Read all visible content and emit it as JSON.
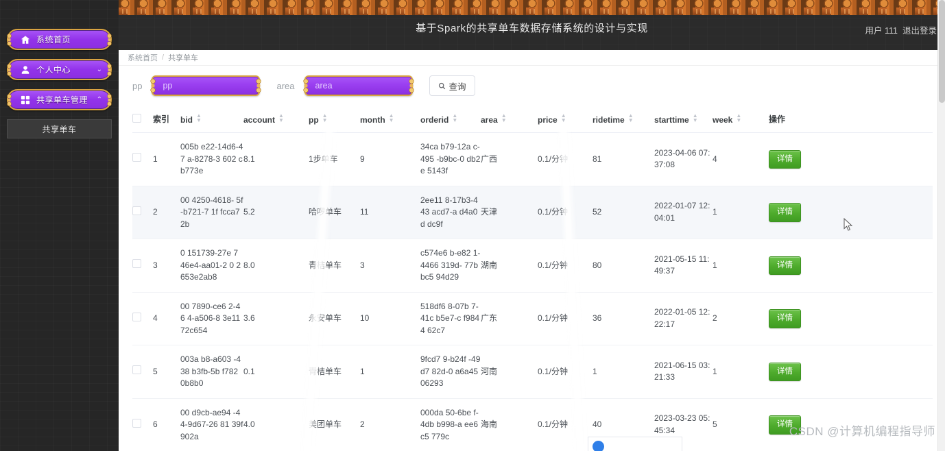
{
  "sidebar": {
    "items": [
      {
        "label": "系统首页",
        "icon": "home-icon",
        "chevron": ""
      },
      {
        "label": "个人中心",
        "icon": "user-icon",
        "chevron": "⌄"
      },
      {
        "label": "共享单车管理",
        "icon": "grid-icon",
        "chevron": "⌃"
      }
    ],
    "sub_item": "共享单车"
  },
  "topbar": {
    "title": "基于Spark的共享单车数据存储系统的设计与实现",
    "user": "用户 111",
    "logout": "退出登录"
  },
  "breadcrumb": {
    "home": "系统首页",
    "separator": "/",
    "current": "共享单车"
  },
  "search": {
    "pp_label": "pp",
    "pp_value": "",
    "pp_placeholder": "pp",
    "area_label": "area",
    "area_value": "",
    "area_placeholder": "area",
    "query_button": "查询"
  },
  "table": {
    "columns": [
      {
        "key": "index",
        "label": "索引",
        "sortable": false
      },
      {
        "key": "bid",
        "label": "bid",
        "sortable": true
      },
      {
        "key": "account",
        "label": "account",
        "sortable": true
      },
      {
        "key": "pp",
        "label": "pp",
        "sortable": true
      },
      {
        "key": "month",
        "label": "month",
        "sortable": true
      },
      {
        "key": "orderid",
        "label": "orderid",
        "sortable": true
      },
      {
        "key": "area",
        "label": "area",
        "sortable": true
      },
      {
        "key": "price",
        "label": "price",
        "sortable": true
      },
      {
        "key": "ridetime",
        "label": "ridetime",
        "sortable": true
      },
      {
        "key": "starttime",
        "label": "starttime",
        "sortable": true
      },
      {
        "key": "week",
        "label": "week",
        "sortable": true
      },
      {
        "key": "action",
        "label": "操作",
        "sortable": false
      }
    ],
    "action_label": "详情",
    "rows": [
      {
        "index": "1",
        "bid": "005b e22-14d6-47 a-8278-3 602 cb773e",
        "account": "8.1",
        "pp": "1步单车",
        "month": "9",
        "orderid": "34ca b79-12a c-495 -b9bc-0 db2e 5143f",
        "area": "广西",
        "price": "0.1/分钟",
        "ridetime": "81",
        "starttime": "2023-04-06 07:37:08",
        "week": "4",
        "hover": false
      },
      {
        "index": "2",
        "bid": "00 4250-4618- 5f-b721-7 1f fcca72b",
        "account": "5.2",
        "pp": "哈啰单车",
        "month": "11",
        "orderid": "2ee11 8-17b3-443 acd7-a d4a0d dc9f",
        "area": "天津",
        "price": "0.1/分钟",
        "ridetime": "52",
        "starttime": "2022-01-07 12:04:01",
        "week": "1",
        "hover": true
      },
      {
        "index": "3",
        "bid": "0 151739-27e 7 46e4-aa01-2 0 2653e2ab8",
        "account": "8.0",
        "pp": "青桔单车",
        "month": "3",
        "orderid": "c574e6 b-e82 1-4466 319d- 77bbc5 94d29",
        "area": "湖南",
        "price": "0.1/分钟",
        "ridetime": "80",
        "starttime": "2021-05-15 11:49:37",
        "week": "1",
        "hover": false
      },
      {
        "index": "4",
        "bid": "00 7890-ce6 2-46 4-a506-8 3e11 72c654",
        "account": "3.6",
        "pp": "永安单车",
        "month": "10",
        "orderid": "518df6 8-07b 7-41c b5e7-c f9844 62c7",
        "area": "广东",
        "price": "0.1/分钟",
        "ridetime": "36",
        "starttime": "2022-01-05 12:22:17",
        "week": "2",
        "hover": false
      },
      {
        "index": "5",
        "bid": "003a b8-a603 -438 b3fb-5b f782 0b8b0",
        "account": "0.1",
        "pp": "青桔单车",
        "month": "1",
        "orderid": "9fcd7 9-b24f -49d7 82d-0 a6a45 06293",
        "area": "河南",
        "price": "0.1/分钟",
        "ridetime": "1",
        "starttime": "2021-06-15 03:21:33",
        "week": "1",
        "hover": false
      },
      {
        "index": "6",
        "bid": "00 d9cb-ae94 -4 4-9d67-26 81 39f902a",
        "account": "4.0",
        "pp": "美团单车",
        "month": "2",
        "orderid": "000da 50-6be f-4db b998-a ee6c5 779c",
        "area": "海南",
        "price": "0.1/分钟",
        "ridetime": "40",
        "starttime": "2023-03-23 05:45:34",
        "week": "5",
        "hover": false
      }
    ]
  },
  "watermark": "CSDN @计算机编程指导师",
  "colors": {
    "accent_purple": "#9333ea",
    "gold_border": "#d9a441",
    "detail_green": "#4eab2c",
    "sidebar_bg": "#262626",
    "ornament_orange": "#c9692a"
  }
}
